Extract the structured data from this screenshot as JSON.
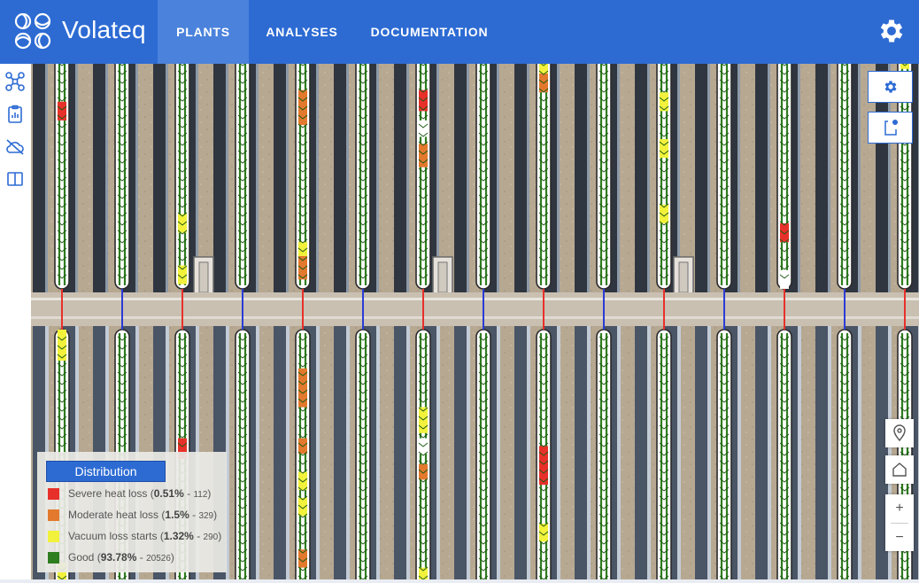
{
  "header": {
    "brand": "Volateq",
    "tabs": [
      {
        "label": "PLANTS",
        "active": true
      },
      {
        "label": "ANALYSES",
        "active": false
      },
      {
        "label": "DOCUMENTATION",
        "active": false
      }
    ],
    "settings_icon": "gear-icon"
  },
  "toolbar": {
    "items": [
      {
        "icon": "drone-icon"
      },
      {
        "icon": "clipboard-icon"
      },
      {
        "icon": "cloud-off-icon"
      },
      {
        "icon": "split-view-icon"
      }
    ]
  },
  "map_controls": {
    "settings_icon": "gear-icon",
    "export_icon": "share-icon",
    "locate_icon": "location-pin-icon",
    "home_icon": "home-icon",
    "zoom_in_label": "+",
    "zoom_out_label": "−"
  },
  "legend": {
    "title": "Distribution",
    "items": [
      {
        "name": "Severe heat loss",
        "percent": "0.51%",
        "count": "112",
        "color": "#e8302a"
      },
      {
        "name": "Moderate heat loss",
        "percent": "1.5%",
        "count": "329",
        "color": "#e2792d"
      },
      {
        "name": "Vacuum loss starts",
        "percent": "1.32%",
        "count": "290",
        "color": "#f2f23c"
      },
      {
        "name": "Good",
        "percent": "93.78%",
        "count": "20526",
        "color": "#2e7d1f"
      }
    ]
  },
  "colors": {
    "brand": "#2d6bd3",
    "good": "#2e7d1f",
    "vacuum": "#f2f23c",
    "moderate": "#e2792d",
    "severe": "#e8302a",
    "connector_blue": "#2a3bd6"
  },
  "loops": [
    {
      "top": [
        [
          "r",
          0.2,
          0.28
        ]
      ],
      "bot": [
        [
          "y",
          0.0,
          0.12
        ],
        [
          "y",
          0.9,
          1.0
        ]
      ],
      "conn": "red"
    },
    {
      "top": [],
      "bot": [],
      "conn": "blue"
    },
    {
      "top": [
        [
          "y",
          0.68,
          0.76
        ],
        [
          "y",
          0.9,
          0.98
        ]
      ],
      "bot": [
        [
          "r",
          0.42,
          0.5
        ]
      ],
      "conn": "red"
    },
    {
      "top": [],
      "bot": [],
      "conn": "blue"
    },
    {
      "top": [
        [
          "o",
          0.15,
          0.3
        ],
        [
          "o",
          0.84,
          0.96
        ],
        [
          "y",
          0.8,
          0.86
        ]
      ],
      "bot": [
        [
          "o",
          0.15,
          0.3
        ],
        [
          "o",
          0.42,
          0.48
        ],
        [
          "y",
          0.55,
          0.62
        ],
        [
          "y",
          0.65,
          0.72
        ],
        [
          "o",
          0.85,
          0.92
        ]
      ],
      "conn": "red"
    },
    {
      "top": [],
      "bot": [],
      "conn": "blue"
    },
    {
      "top": [
        [
          "r",
          0.15,
          0.24
        ],
        [
          "o",
          0.38,
          0.48
        ],
        [
          "w",
          0.28,
          0.35
        ]
      ],
      "bot": [
        [
          "y",
          0.3,
          0.4
        ],
        [
          "w",
          0.42,
          0.48
        ],
        [
          "o",
          0.52,
          0.58
        ],
        [
          "y",
          0.92,
          0.98
        ]
      ],
      "conn": "red"
    },
    {
      "top": [],
      "bot": [],
      "conn": "blue"
    },
    {
      "top": [
        [
          "y",
          0.0,
          0.08
        ],
        [
          "o",
          0.08,
          0.16
        ]
      ],
      "bot": [
        [
          "r",
          0.45,
          0.6
        ],
        [
          "y",
          0.75,
          0.82
        ]
      ],
      "conn": "red"
    },
    {
      "top": [],
      "bot": [],
      "conn": "blue"
    },
    {
      "top": [
        [
          "y",
          0.16,
          0.24
        ],
        [
          "y",
          0.36,
          0.44
        ],
        [
          "y",
          0.64,
          0.72
        ]
      ],
      "bot": [],
      "conn": "red"
    },
    {
      "top": [],
      "bot": [],
      "conn": "blue"
    },
    {
      "top": [
        [
          "r",
          0.72,
          0.8
        ],
        [
          "w",
          0.92,
          1.0
        ]
      ],
      "bot": [],
      "conn": "red"
    },
    {
      "top": [],
      "bot": [],
      "conn": "blue"
    },
    {
      "top": [
        [
          "y",
          0.0,
          0.06
        ]
      ],
      "bot": [],
      "conn": "red"
    }
  ]
}
